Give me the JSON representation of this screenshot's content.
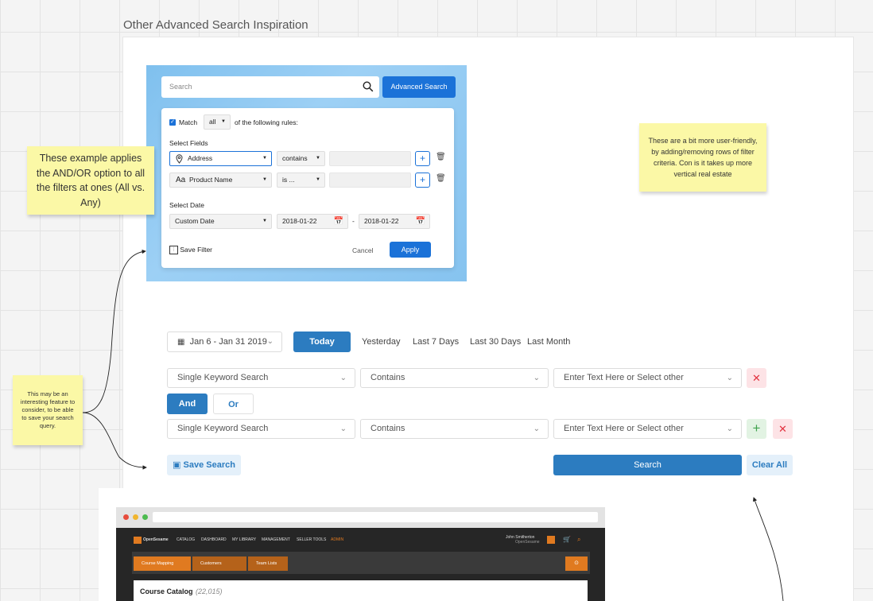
{
  "frame_title": "Other Advanced Search Inspiration",
  "mockup1": {
    "search_placeholder": "Search",
    "advanced_button": "Advanced Search",
    "match_label": "Match",
    "match_value": "all",
    "rules_text": "of the following rules:",
    "select_fields_label": "Select Fields",
    "row1": {
      "field": "Address",
      "operator": "contains"
    },
    "row2": {
      "field_prefix": "Aa",
      "field": "Product Name",
      "operator": "is ..."
    },
    "select_date_label": "Select Date",
    "date_type": "Custom Date",
    "date_from": "2018-01-22",
    "date_sep": "-",
    "date_to": "2018-01-22",
    "save_filter": "Save Filter",
    "cancel": "Cancel",
    "apply": "Apply"
  },
  "notes": {
    "andor": "These example applies the AND/OR option to all the filters at ones (All vs. Any)",
    "userfriendly": "These are a bit more user-friendly, by adding/removing rows of filter criteria. Con is it takes up more vertical real estate",
    "savequery": "This may be an interesting feature to consider, to be able to save your search query."
  },
  "mockup2": {
    "date_range": "Jan 6 - Jan 31 2019",
    "today": "Today",
    "quick_ranges": [
      "Yesterday",
      "Last 7 Days",
      "Last 30 Days",
      "Last Month"
    ],
    "row1": {
      "field": "Single Keyword Search",
      "operator": "Contains",
      "value_placeholder": "Enter Text Here or Select other"
    },
    "and": "And",
    "or": "Or",
    "row2": {
      "field": "Single Keyword Search",
      "operator": "Contains",
      "value_placeholder": "Enter Text Here or Select other"
    },
    "save_search": "Save Search",
    "search": "Search",
    "clear_all": "Clear All"
  },
  "mockup3": {
    "brand": "OpenSesame",
    "nav": [
      "CATALOG",
      "DASHBOARD",
      "MY LIBRARY",
      "MANAGEMENT",
      "SELLER TOOLS",
      "ADMIN"
    ],
    "user_name": "John Smitherton",
    "user_org": "OpenSesame",
    "tabs": [
      "Course Mapping",
      "Customers",
      "Team Lists"
    ],
    "catalog_title": "Course Catalog",
    "catalog_count": "(22,015)"
  },
  "colors": {
    "primary_blue": "#1b72d8",
    "mockup2_blue": "#2c7cc0",
    "sticky": "#fbf8a6",
    "danger": "#e2323f",
    "success": "#3fa34d",
    "opensesame_orange": "#e07a20"
  }
}
